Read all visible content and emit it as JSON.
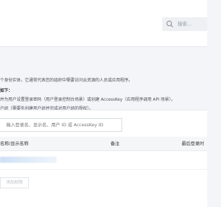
{
  "header": {
    "search": {
      "icon": "search-icon",
      "placeholder": "搜索..."
    }
  },
  "intro": {
    "line1": "个身份实体，它通常代表您的组织中需要访问云资源的人员或应用程序。",
    "line2": "如下：",
    "line3": "并为用户设置登录密码（用户登录控制台场景）或创建 AccessKey（应用程序调用 API 场景）。",
    "line4": "户组（需要先创建用户组并完成对用户组的授权）。"
  },
  "table": {
    "filter_placeholder": "输入登录名、显示名、用户 ID 或 AccessKey ID",
    "columns": {
      "name": "名称/显示名称",
      "note": "备注",
      "last_login": "最后登录时"
    },
    "rows": [
      {
        "name": ""
      }
    ]
  },
  "actions": {
    "add_user_label": "添加权限"
  },
  "colors": {
    "page_bg": "#f3f5f8",
    "panel_bg": "#ffffff",
    "header_bg": "#f5f6f8"
  }
}
